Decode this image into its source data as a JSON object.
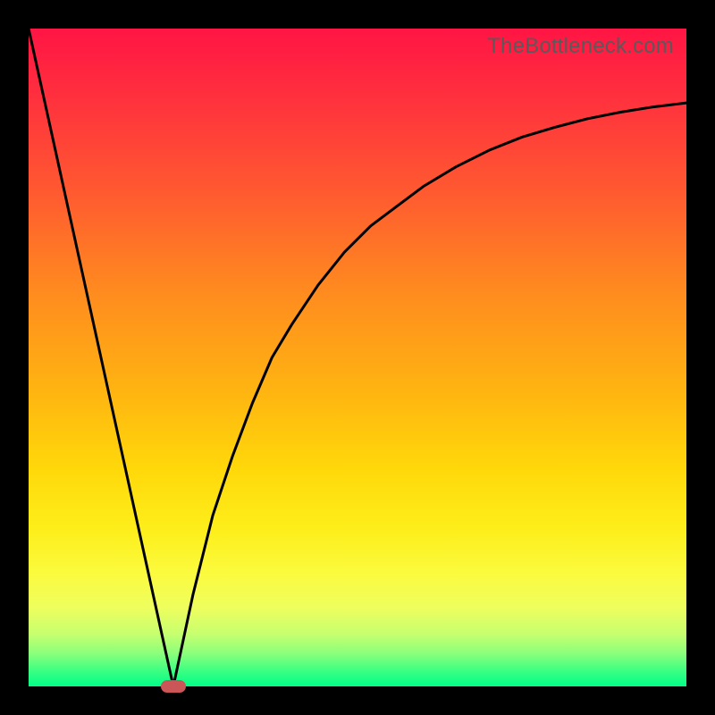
{
  "watermark": "TheBottleneck.com",
  "chart_data": {
    "type": "line",
    "title": "",
    "xlabel": "",
    "ylabel": "",
    "xlim": [
      0,
      100
    ],
    "ylim": [
      0,
      100
    ],
    "grid": false,
    "legend": false,
    "series": [
      {
        "name": "left-segment",
        "x": [
          0,
          22
        ],
        "y": [
          100,
          0
        ]
      },
      {
        "name": "right-segment",
        "x": [
          22,
          25,
          28,
          31,
          34,
          37,
          40,
          44,
          48,
          52,
          56,
          60,
          65,
          70,
          75,
          80,
          85,
          90,
          95,
          100
        ],
        "y": [
          0,
          14,
          26,
          35,
          43,
          50,
          55,
          61,
          66,
          70,
          73,
          76,
          79,
          81.5,
          83.5,
          85,
          86.3,
          87.3,
          88.1,
          88.7
        ]
      }
    ],
    "marker": {
      "x": 22,
      "y": 0,
      "color": "#cb5658"
    },
    "background_gradient": {
      "top": "#ff1544",
      "bottom": "#00fd88",
      "stops": [
        "#ff1544",
        "#ff5a30",
        "#ffb411",
        "#fdee1a",
        "#8bff7b",
        "#00fd88"
      ]
    }
  }
}
